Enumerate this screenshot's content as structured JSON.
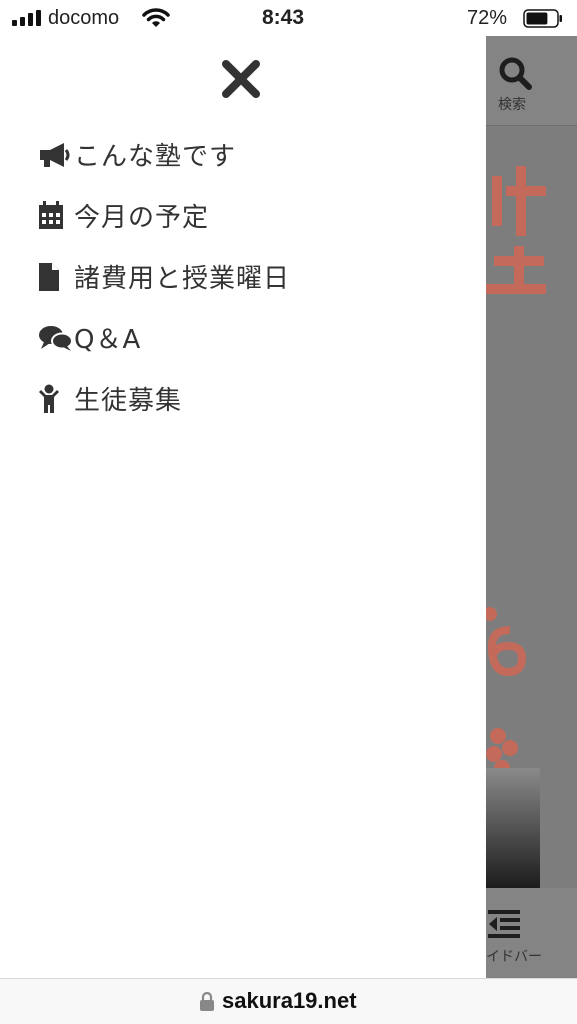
{
  "status_bar": {
    "carrier": "docomo",
    "time": "8:43",
    "battery_percent": "72%",
    "battery_level": 0.72
  },
  "drawer": {
    "close_icon": "close-icon",
    "items": [
      {
        "label": "こんな塾です",
        "icon": "megaphone-icon"
      },
      {
        "label": "今月の予定",
        "icon": "calendar-icon"
      },
      {
        "label": "諸費用と授業曜日",
        "icon": "document-icon"
      },
      {
        "label": "Q＆A",
        "icon": "chat-bubbles-icon"
      },
      {
        "label": "生徒募集",
        "icon": "child-icon"
      }
    ]
  },
  "background_page": {
    "search_label": "検索",
    "sidebar_label": "イドバー"
  },
  "url_bar": {
    "domain": "sakura19.net"
  },
  "colors": {
    "icon": "#333333",
    "overlay": "#7d7d7d",
    "accent_dimmed": "#c77060"
  }
}
